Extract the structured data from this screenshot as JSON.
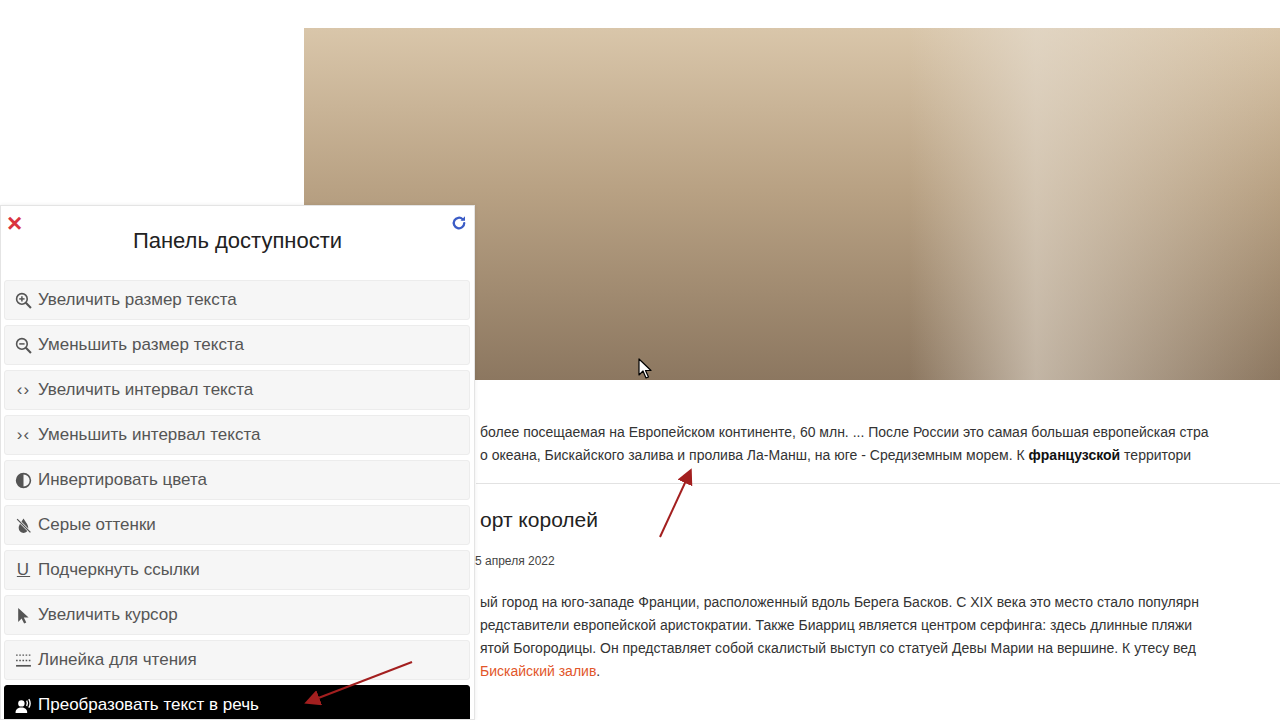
{
  "accessibility_panel": {
    "close": "×",
    "title": "Панель доступности",
    "items": [
      {
        "label": "Увеличить размер текста",
        "kind": "zoomin",
        "icon": "",
        "selected": false
      },
      {
        "label": "Уменьшить размер текста",
        "kind": "zoomout",
        "icon": "",
        "selected": false
      },
      {
        "label": "Увеличить интервал текста",
        "kind": "glyph",
        "icon": "‹›",
        "selected": false
      },
      {
        "label": "Уменьшить интервал текста",
        "kind": "glyph",
        "icon": "›‹",
        "selected": false
      },
      {
        "label": "Инвертировать цвета",
        "kind": "contrast",
        "icon": "",
        "selected": false
      },
      {
        "label": "Серые оттенки",
        "kind": "grayscale",
        "icon": "",
        "selected": false
      },
      {
        "label": "Подчеркнуть ссылки",
        "kind": "glyph",
        "icon": "U",
        "selected": false
      },
      {
        "label": "Увеличить курсор",
        "kind": "cursor",
        "icon": "",
        "selected": false
      },
      {
        "label": "Линейка для чтения",
        "kind": "ruler",
        "icon": "",
        "selected": false
      },
      {
        "label": "Преобразовать текст в речь",
        "kind": "speech",
        "icon": "",
        "selected": true
      }
    ]
  },
  "intro": {
    "lines": [
      [
        {
          "text": "более посещаемая на Европейском континенте, 60 млн. ... После России это самая большая европейская стра",
          "kind": "plain"
        }
      ],
      [
        {
          "text": "о океана, Бискайского залива и пролива Ла-Манш, на юге - Средиземным морем. К ",
          "kind": "plain"
        },
        {
          "text": "французской",
          "kind": "bold"
        },
        {
          "text": " территори",
          "kind": "plain"
        }
      ]
    ]
  },
  "post": {
    "title": "орт королей",
    "date": "5 апреля 2022",
    "lines": [
      [
        {
          "text": "ый город на юго-западе Франции, расположенный вдоль Берега Басков. С XIX века это место стало популярн",
          "kind": "plain"
        }
      ],
      [
        {
          "text": "редставители европейской аристократии. Также Биарриц является центром серфинга: здесь длинные пляжи",
          "kind": "plain"
        }
      ],
      [
        {
          "text": "ятой Богородицы. Он представляет собой скалистый выступ со статуей Девы Марии на вершине. К утесу вед",
          "kind": "plain"
        }
      ],
      [
        {
          "text": "Бискайский залив",
          "kind": "link"
        },
        {
          "text": ".",
          "kind": "plain"
        }
      ]
    ]
  }
}
